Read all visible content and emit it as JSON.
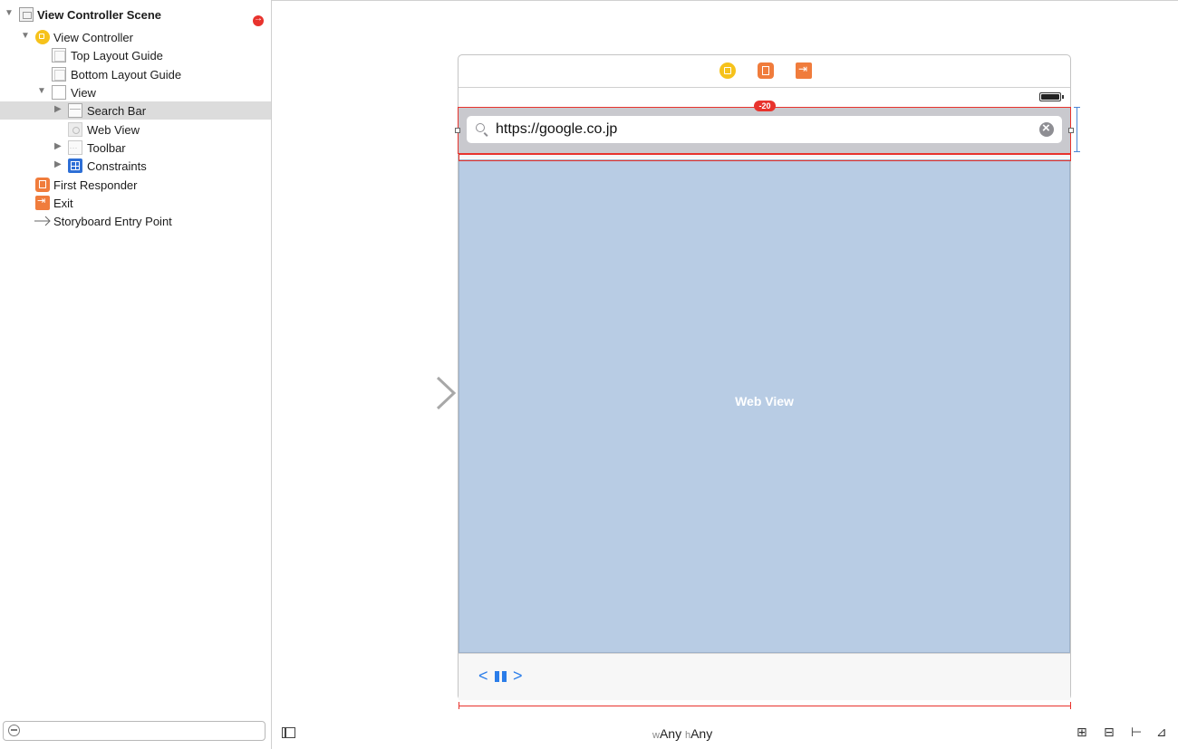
{
  "outline": {
    "scene_title": "View Controller Scene",
    "items": [
      {
        "label": "View Controller"
      },
      {
        "label": "Top Layout Guide"
      },
      {
        "label": "Bottom Layout Guide"
      },
      {
        "label": "View"
      },
      {
        "label": "Search Bar"
      },
      {
        "label": "Web View"
      },
      {
        "label": "Toolbar"
      },
      {
        "label": "Constraints"
      },
      {
        "label": "First Responder"
      },
      {
        "label": "Exit"
      },
      {
        "label": "Storyboard Entry Point"
      }
    ],
    "selected": "Search Bar"
  },
  "canvas": {
    "search_text": "https://google.co.jp",
    "constraint_badge": "-20",
    "web_view_label": "Web View",
    "toolbar": {
      "back": "<",
      "forward": ">"
    }
  },
  "bottom_bar": {
    "width_prefix": "w",
    "width_value": "Any",
    "height_prefix": "h",
    "height_value": "Any"
  },
  "colors": {
    "selection": "#dcdcdc",
    "web_view_bg": "#b8cce4",
    "constraint_red": "#e8332d",
    "accent_blue": "#2b7de9"
  }
}
